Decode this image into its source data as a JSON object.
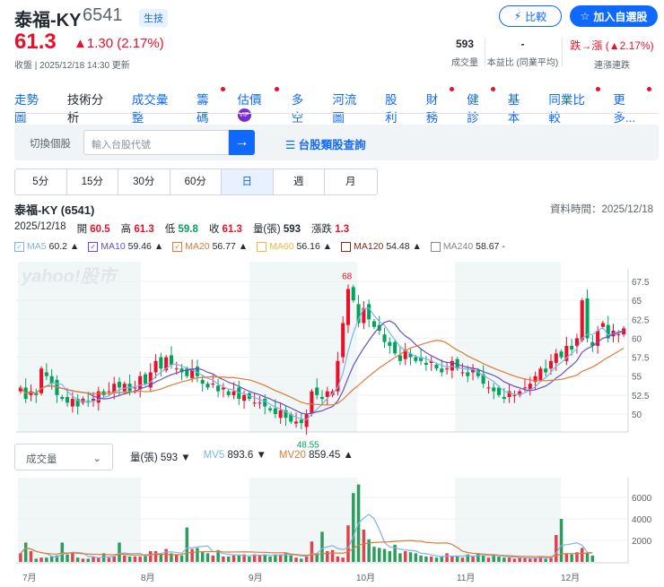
{
  "header": {
    "name": "泰福-KY",
    "code": "6541",
    "tag": "生技",
    "compare_label": "比較",
    "favorite_label": "加入自選股"
  },
  "quote": {
    "price": "61.3",
    "change": "▲1.30 (2.17%)",
    "updated": "收盤 | 2025/12/18 14:30 更新",
    "stats": [
      {
        "value": "593",
        "label": "成交量"
      },
      {
        "value": "-",
        "label": "本益比 (同業平均)"
      },
      {
        "value": "跌→漲 (▲2.17%)",
        "label": "連漲連跌"
      }
    ]
  },
  "tabs": [
    {
      "label": "走勢圖"
    },
    {
      "label": "技術分析",
      "active": true
    },
    {
      "label": "成交彙整"
    },
    {
      "label": "籌碼",
      "dot": true
    },
    {
      "label": "估價",
      "vip": "VIP",
      "dot": true
    },
    {
      "label": "多空"
    },
    {
      "label": "河流圖"
    },
    {
      "label": "股利"
    },
    {
      "label": "財務",
      "dot": true
    },
    {
      "label": "健診",
      "dot": true
    },
    {
      "label": "基本"
    },
    {
      "label": "同業比較",
      "dot": true
    },
    {
      "label": "更多...",
      "dot": true
    }
  ],
  "search": {
    "label": "切換個股",
    "placeholder": "輸入台股代號",
    "go": "→",
    "link": "☰ 台股類股查詢"
  },
  "periods": [
    "5分",
    "15分",
    "30分",
    "60分",
    "日",
    "週",
    "月"
  ],
  "active_period": "日",
  "info": {
    "title": "泰福-KY (6541)",
    "data_time": "資料時間：2025/12/18",
    "date": "2025/12/18",
    "open_label": "開",
    "open": "60.5",
    "high_label": "高",
    "high": "61.3",
    "low_label": "低",
    "low": "59.8",
    "close_label": "收",
    "close": "61.3",
    "vol_label": "量(張)",
    "vol": "593",
    "chg_label": "漲跌",
    "chg": "1.3"
  },
  "ma_legend": [
    {
      "name": "MA5",
      "value": "60.2 ▲",
      "color": "#7fb3e6",
      "checked": true
    },
    {
      "name": "MA10",
      "value": "59.46 ▲",
      "color": "#6a4fc8",
      "checked": true
    },
    {
      "name": "MA20",
      "value": "56.77 ▲",
      "color": "#e07b39",
      "checked": true
    },
    {
      "name": "MA60",
      "value": "56.16 ▲",
      "color": "#f0b840",
      "checked": false
    },
    {
      "name": "MA120",
      "value": "54.48 ▲",
      "color": "#8b2a1a",
      "checked": false
    },
    {
      "name": "MA240",
      "value": "58.67 -",
      "color": "#888888",
      "checked": false
    }
  ],
  "watermark": "yahoo!股市",
  "volume_panel": {
    "select": "成交量",
    "vol_label": "量(張)",
    "vol": "593 ▼",
    "mv5_label": "MV5",
    "mv5": "893.6 ▼",
    "mv20_label": "MV20",
    "mv20": "859.45 ▲"
  },
  "colors": {
    "up": "#eb0f29",
    "down": "#00a35a",
    "accent": "#0f69ff"
  },
  "chart_data": {
    "type": "candlestick",
    "price_ticks": [
      "50",
      "52.5",
      "55",
      "57.5",
      "60",
      "62.5",
      "65",
      "67.5"
    ],
    "volume_ticks": [
      "2000",
      "4000",
      "6000"
    ],
    "months": [
      "7月",
      "8月",
      "9月",
      "10月",
      "11月",
      "12月"
    ],
    "annotations": {
      "high": "68",
      "low": "48.55"
    },
    "close": [
      53.5,
      52,
      53,
      52.5,
      56,
      55,
      54,
      52.5,
      52,
      51.5,
      52,
      51,
      52,
      51.5,
      52,
      53,
      52.5,
      53,
      54,
      53.5,
      54,
      53,
      53.5,
      55,
      54,
      55.5,
      57,
      56,
      57.5,
      56.5,
      56,
      55.5,
      55,
      56,
      55,
      54,
      53.5,
      54,
      53,
      53.5,
      52.5,
      53,
      52,
      52.5,
      52,
      51.5,
      51.5,
      51,
      50.5,
      50,
      50.5,
      49.5,
      49,
      49,
      48.8,
      50,
      53,
      52.5,
      52,
      53,
      53,
      57,
      62,
      66.5,
      65,
      62,
      64,
      62.5,
      61.5,
      61,
      59.5,
      59,
      58,
      57,
      58.5,
      57.5,
      57,
      57,
      56.5,
      57,
      56,
      55.5,
      56,
      57,
      56,
      55.5,
      55,
      56,
      55,
      54,
      53.5,
      53,
      52.5,
      52,
      53,
      52.5,
      53,
      53.5,
      54,
      55,
      56,
      55.5,
      57,
      58,
      57.5,
      59,
      58.5,
      60,
      65,
      60,
      59,
      61,
      62,
      60,
      61,
      60.5,
      61.3
    ],
    "volume": [
      800,
      1800,
      1000,
      300,
      400,
      400,
      500,
      600,
      1800,
      700,
      900,
      400,
      300,
      300,
      500,
      400,
      800,
      400,
      500,
      1800,
      600,
      500,
      500,
      500,
      700,
      1000,
      1000,
      700,
      1200,
      800,
      700,
      600,
      3200,
      1200,
      1300,
      900,
      800,
      600,
      1100,
      500,
      500,
      600,
      600,
      700,
      500,
      700,
      600,
      700,
      500,
      700,
      700,
      800,
      600,
      400,
      300,
      500,
      1900,
      800,
      2800,
      1000,
      1100,
      500,
      400,
      3400,
      6400,
      7200,
      3000,
      2100,
      1400,
      1300,
      1200,
      1000,
      1600,
      800,
      1000,
      900,
      800,
      600,
      500,
      500,
      400,
      500,
      800,
      500,
      500,
      400,
      700,
      500,
      800,
      600,
      400,
      700,
      500,
      400,
      400,
      300,
      400,
      400,
      300,
      400,
      500,
      300,
      400,
      2500,
      4000,
      800,
      700,
      900,
      1300,
      800,
      593
    ]
  }
}
